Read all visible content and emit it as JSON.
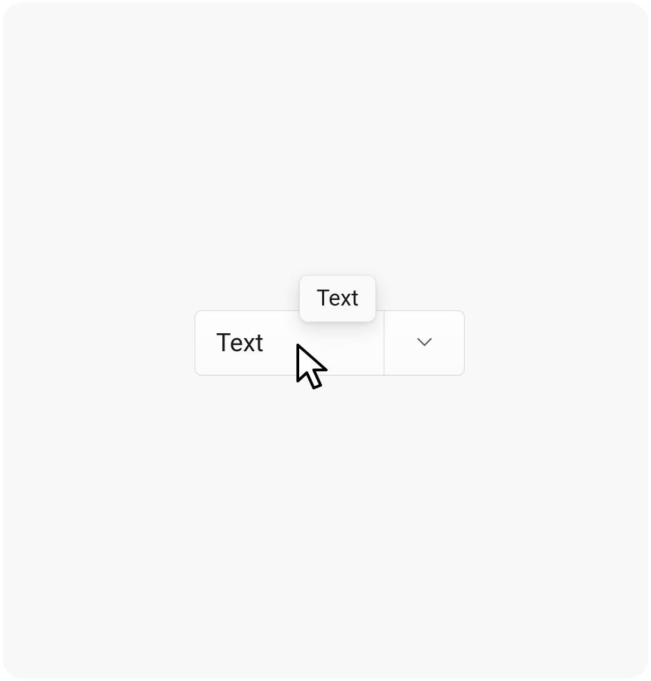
{
  "split_button": {
    "label": "Text"
  },
  "tooltip": {
    "text": "Text"
  }
}
